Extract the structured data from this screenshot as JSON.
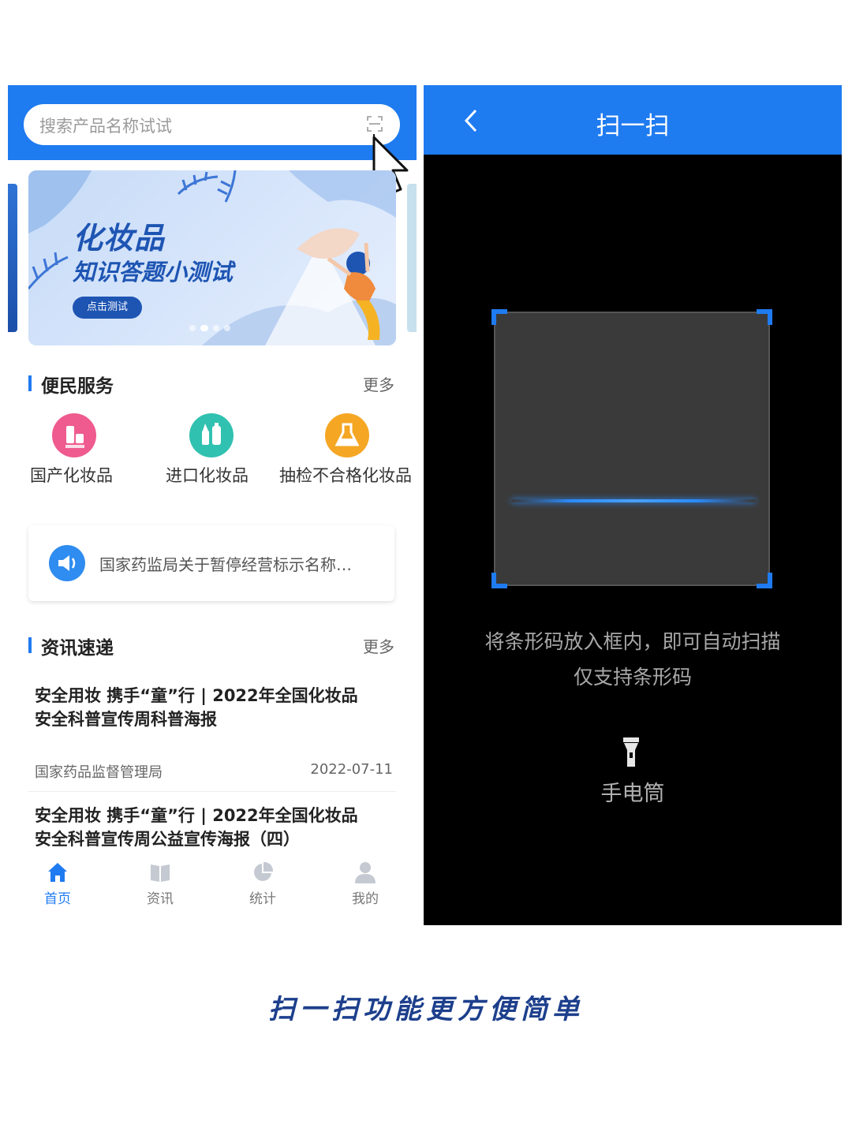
{
  "left_screen": {
    "search": {
      "placeholder": "搜索产品名称试试"
    },
    "banner": {
      "title": "化妆品",
      "subtitle": "知识答题小测试",
      "button": "点击测试",
      "slide_index": 2,
      "slide_count": 4
    },
    "services": {
      "title": "便民服务",
      "more": "更多",
      "items": [
        {
          "label": "国产化妆品",
          "icon": "cosmetics-bottles-icon",
          "color": "#ef5b8f"
        },
        {
          "label": "进口化妆品",
          "icon": "lipstick-bottle-icon",
          "color": "#31c1b0"
        },
        {
          "label": "抽检不合格化妆品",
          "icon": "lab-flask-icon",
          "color": "#f5a623"
        }
      ]
    },
    "notice": {
      "text": "国家药监局关于暂停经营标示名称…",
      "icon": "megaphone-icon"
    },
    "news": {
      "title": "资讯速递",
      "more": "更多",
      "items": [
        {
          "title_line1": "安全用妆 携手“童”行 | 2022年全国化妆品",
          "title_line2": "安全科普宣传周科普海报",
          "source": "国家药品监督管理局",
          "date": "2022-07-11"
        },
        {
          "title_line1": "安全用妆 携手“童”行 | 2022年全国化妆品",
          "title_line2": "安全科普宣传周公益宣传海报（四）"
        }
      ]
    },
    "tabs": [
      {
        "label": "首页",
        "icon": "home-icon",
        "active": true
      },
      {
        "label": "资讯",
        "icon": "book-icon",
        "active": false
      },
      {
        "label": "统计",
        "icon": "pie-chart-icon",
        "active": false
      },
      {
        "label": "我的",
        "icon": "user-icon",
        "active": false
      }
    ]
  },
  "right_screen": {
    "title": "扫一扫",
    "hint_line1": "将条形码放入框内，即可自动扫描",
    "hint_line2": "仅支持条形码",
    "torch_label": "手电筒"
  },
  "caption": "扫一扫功能更方便简单",
  "colors": {
    "primary": "#1f7bf0",
    "banner_text": "#1e55b3",
    "caption": "#1d3f8c"
  }
}
